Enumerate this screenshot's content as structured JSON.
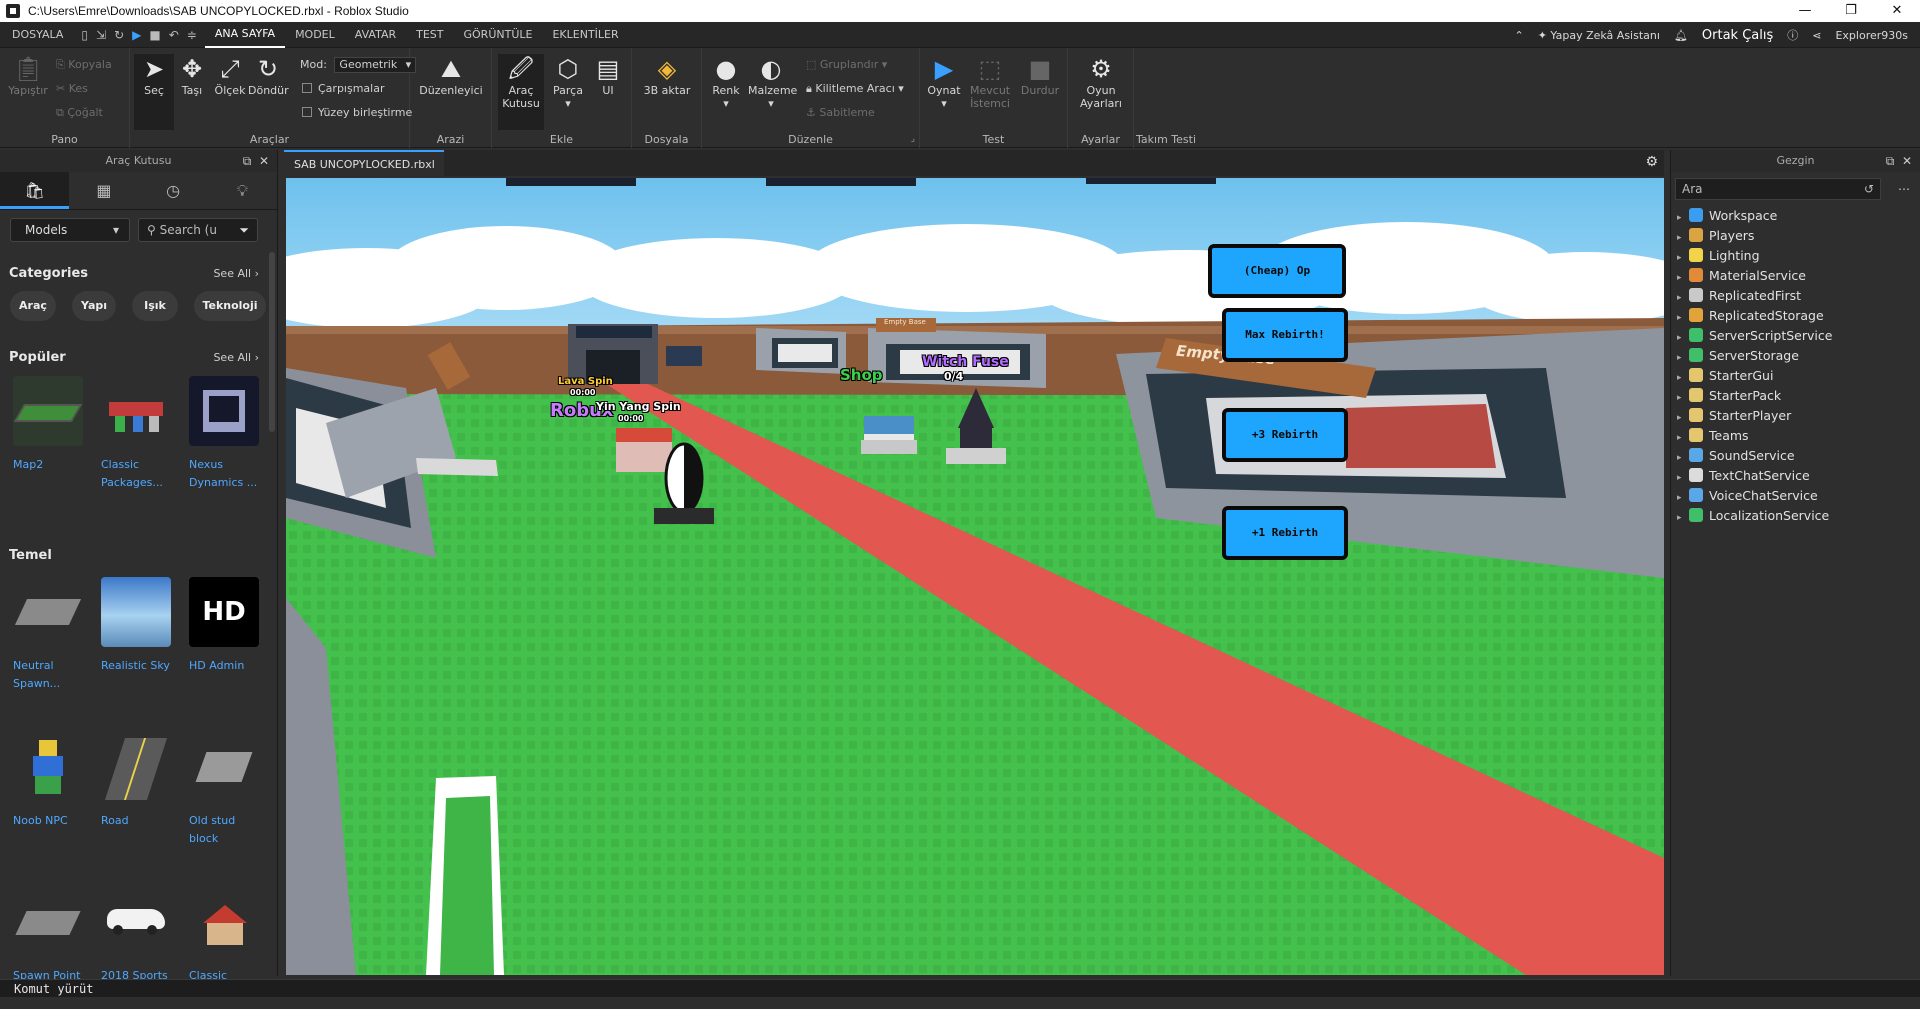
{
  "window": {
    "title": "C:\\Users\\Emre\\Downloads\\SAB UNCOPYLOCKED.rbxl - Roblox Studio",
    "minimize": "—",
    "maximize": "❐",
    "close": "✕"
  },
  "menubar": {
    "file": "DOSYALA",
    "tabs": [
      "ANA SAYFA",
      "MODEL",
      "AVATAR",
      "TEST",
      "GÖRÜNTÜLE",
      "EKLENTİLER"
    ],
    "active_tab": "ANA SAYFA",
    "assistant": "Yapay Zekâ Asistanı",
    "collaborate": "Ortak Çalış",
    "user": "Explorer930s"
  },
  "ribbon": {
    "pano": {
      "label": "Pano",
      "paste": "Yapıştır",
      "copy": "Kopyala",
      "cut": "Kes",
      "duplicate": "Çoğalt"
    },
    "araclar": {
      "label": "Araçlar",
      "select": "Seç",
      "move": "Taşı",
      "scale": "Ölçek",
      "rotate": "Döndür",
      "mode_label": "Mod:",
      "mode_value": "Geometrik",
      "collisions": "Çarpışmalar",
      "surface_join": "Yüzey birleştirme"
    },
    "arazi": {
      "label": "Arazi",
      "editor": "Düzenleyici"
    },
    "ekle": {
      "label": "Ekle",
      "toolbox_1": "Araç",
      "toolbox_2": "Kutusu",
      "part": "Parça",
      "ui": "UI"
    },
    "dosyala": {
      "label": "Dosyala",
      "import3d": "3B aktar"
    },
    "duzenle": {
      "label": "Düzenle",
      "color": "Renk",
      "material": "Malzeme",
      "group": "Gruplandır",
      "lock": "Kilitleme Aracı",
      "anchor": "Sabitleme"
    },
    "test": {
      "label": "Test",
      "play": "Oynat",
      "current_1": "Mevcut",
      "current_2": "İstemci",
      "stop": "Durdur"
    },
    "ayarlar": {
      "label": "Ayarlar",
      "game_settings_1": "Oyun",
      "game_settings_2": "Ayarları"
    },
    "takim": {
      "label": "Takım Testi"
    }
  },
  "toolbox": {
    "title": "Araç Kutusu",
    "dropdown": "Models",
    "search_placeholder": "Search (u",
    "categories_title": "Categories",
    "see_all": "See All",
    "categories": [
      "Araç",
      "Yapı",
      "Işık",
      "Teknoloji"
    ],
    "popular_title": "Popüler",
    "popular": [
      {
        "name_1": "Map2",
        "name_2": ""
      },
      {
        "name_1": "Classic",
        "name_2": "Packages..."
      },
      {
        "name_1": "Nexus",
        "name_2": "Dynamics ..."
      }
    ],
    "basic_title": "Temel",
    "basic": [
      {
        "name_1": "Neutral",
        "name_2": "Spawn..."
      },
      {
        "name_1": "Realistic Sky",
        "name_2": ""
      },
      {
        "name_1": "HD Admin",
        "name_2": ""
      },
      {
        "name_1": "Noob NPC",
        "name_2": ""
      },
      {
        "name_1": "Road",
        "name_2": ""
      },
      {
        "name_1": "Old stud",
        "name_2": "block"
      },
      {
        "name_1": "Spawn Point",
        "name_2": ""
      },
      {
        "name_1": "2018 Sports",
        "name_2": ""
      },
      {
        "name_1": "Classic",
        "name_2": ""
      }
    ],
    "hd_text": "HD"
  },
  "document": {
    "tab": "SAB UNCOPYLOCKED.rbxl"
  },
  "viewport": {
    "gui_buttons": [
      "(Cheap) Op Brainrot!",
      "Max Rebirth!",
      "+3 Rebirth",
      "+1 Rebirth"
    ],
    "billboards": {
      "shop": "Shop",
      "witch": "Witch Fuse",
      "witch_count": "0/4",
      "lava": "Lava Spin",
      "lava_timer": "00:00",
      "robux": "Robux",
      "yinyang": "Yin Yang Spin",
      "yinyang_timer": "00:00",
      "empty_base": "Empty Base",
      "empty_sign": "Empty Base"
    },
    "colors": {
      "sky": "#8fd0f5",
      "grass": "#44c04c",
      "path": "#e2574f",
      "wall": "#8b5a3a",
      "gui": "#1ea6ff"
    }
  },
  "explorer": {
    "title": "Gezgin",
    "filter_placeholder": "Ara",
    "items": [
      {
        "name": "Workspace",
        "color": "#3a9df0"
      },
      {
        "name": "Players",
        "color": "#d9a441"
      },
      {
        "name": "Lighting",
        "color": "#f2d44a"
      },
      {
        "name": "MaterialService",
        "color": "#e08a3a"
      },
      {
        "name": "ReplicatedFirst",
        "color": "#c9c9c9"
      },
      {
        "name": "ReplicatedStorage",
        "color": "#e0a43a"
      },
      {
        "name": "ServerScriptService",
        "color": "#3fbf6a"
      },
      {
        "name": "ServerStorage",
        "color": "#3fbf6a"
      },
      {
        "name": "StarterGui",
        "color": "#e3c66e"
      },
      {
        "name": "StarterPack",
        "color": "#e3c66e"
      },
      {
        "name": "StarterPlayer",
        "color": "#e3c66e"
      },
      {
        "name": "Teams",
        "color": "#e3c66e"
      },
      {
        "name": "SoundService",
        "color": "#5aa7e8"
      },
      {
        "name": "TextChatService",
        "color": "#dcdcdc"
      },
      {
        "name": "VoiceChatService",
        "color": "#5aa7e8"
      },
      {
        "name": "LocalizationService",
        "color": "#3fbf6a"
      }
    ]
  },
  "command_bar": {
    "placeholder": "Komut yürüt"
  }
}
